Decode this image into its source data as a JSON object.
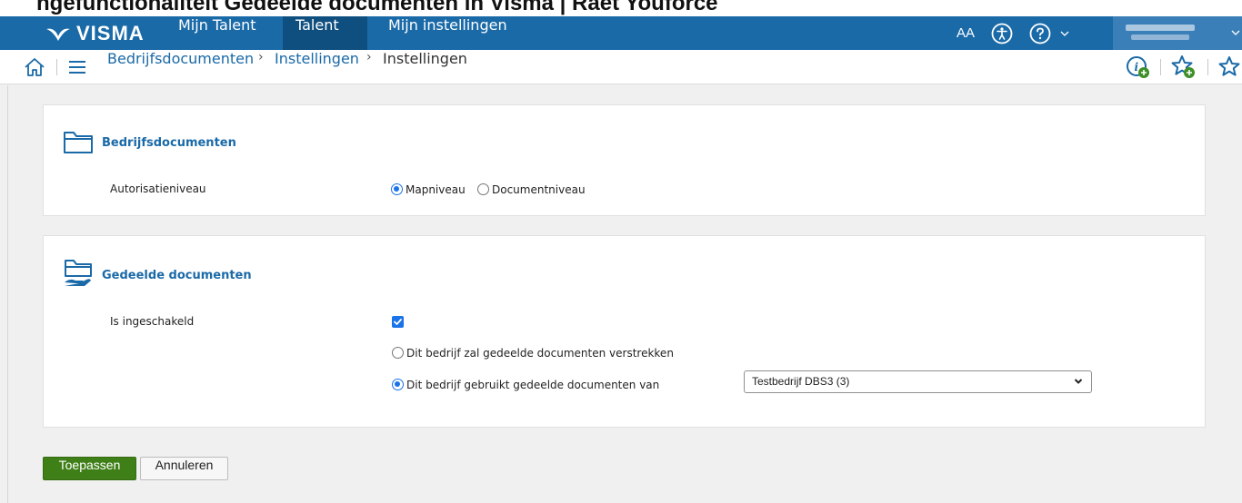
{
  "top_cut_text": "ngefunctionaliteit Gedeelde documenten in Visma | Raet Youforce",
  "app": {
    "logo_text": "VISMA",
    "nav": [
      {
        "label": "Mijn Talent",
        "active": false
      },
      {
        "label": "Talent",
        "active": true
      },
      {
        "label": "Mijn instellingen",
        "active": false
      }
    ],
    "font_size_label": "AA"
  },
  "breadcrumb": {
    "items": [
      "Bedrijfsdocumenten",
      "Instellingen",
      "Instellingen"
    ],
    "separator": "›"
  },
  "card1": {
    "title": "Bedrijfsdocumenten",
    "field_label": "Autorisatieniveau",
    "options": [
      {
        "label": "Mapniveau",
        "checked": true
      },
      {
        "label": "Documentniveau",
        "checked": false
      }
    ]
  },
  "card2": {
    "title": "Gedeelde documenten",
    "enabled_label": "Is ingeschakeld",
    "enabled": true,
    "option_provide": {
      "label": "Dit bedrijf zal gedeelde documenten verstrekken",
      "checked": false
    },
    "option_use": {
      "label": "Dit bedrijf gebruikt gedeelde documenten van",
      "checked": true
    },
    "company_select": "Testbedrijf DBS3 (3)"
  },
  "actions": {
    "apply_label": "Toepassen",
    "cancel_label": "Annuleren"
  },
  "colors": {
    "brand": "#1a6aa8",
    "primary_button": "#3f7f18",
    "radio_accent": "#1a73e8"
  }
}
